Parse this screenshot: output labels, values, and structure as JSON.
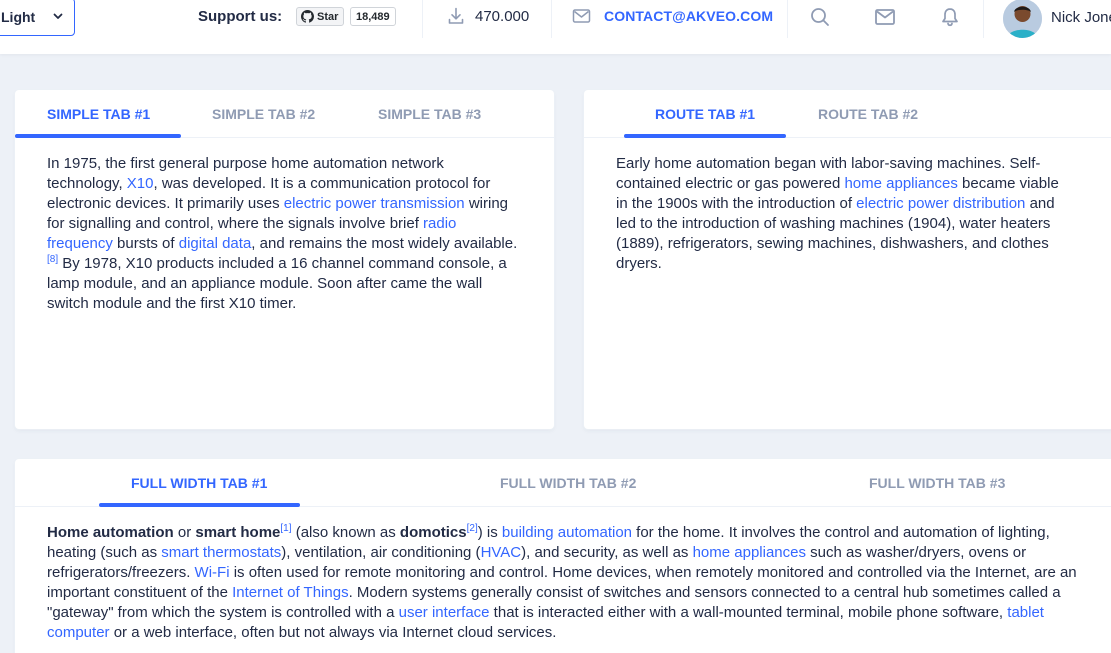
{
  "header": {
    "theme_select_value": "Light",
    "support_label": "Support us:",
    "github_star_label": "Star",
    "github_star_count": "18,489",
    "downloads_count": "470.000",
    "contact_email": "CONTACT@AKVEO.COM",
    "user_name": "Nick Jones"
  },
  "simple_tabs": {
    "tabs": [
      "SIMPLE TAB #1",
      "SIMPLE TAB #2",
      "SIMPLE TAB #3"
    ],
    "active_index": 0,
    "content": {
      "t1": "In 1975, the first general purpose home automation network technology, ",
      "l1": "X10",
      "t2": ", was developed. It is a communication protocol for electronic devices. It primarily uses ",
      "l2": "electric power transmission",
      "t3": " wiring for signalling and control, where the signals involve brief ",
      "l3": "radio frequency",
      "t4": " bursts of ",
      "l4": "digital data",
      "t5": ", and remains the most widely available.",
      "ref": "[8]",
      "t6": " By 1978, X10 products included a 16 channel command console, a lamp module, and an appliance module. Soon after came the wall switch module and the first X10 timer."
    }
  },
  "route_tabs": {
    "tabs": [
      "ROUTE TAB #1",
      "ROUTE TAB #2"
    ],
    "active_index": 0,
    "content": {
      "t1": "Early home automation began with labor-saving machines. Self-contained electric or gas powered ",
      "l1": "home appliances",
      "t2": " became viable in the 1900s with the introduction of ",
      "l2": "electric power distribution",
      "t3": " and led to the introduction of washing machines (1904), water heaters (1889), refrigerators, sewing machines, dishwashers, and clothes dryers."
    }
  },
  "full_tabs": {
    "tabs": [
      "FULL WIDTH TAB #1",
      "FULL WIDTH TAB #2",
      "FULL WIDTH TAB #3"
    ],
    "active_index": 0,
    "content": {
      "b1": "Home automation",
      "t1": " or ",
      "b2": "smart home",
      "ref1": "[1]",
      "t2": " (also known as ",
      "b3": "domotics",
      "ref2": "[2]",
      "t3": ") is ",
      "l1": "building automation",
      "t4": " for the home. It involves the control and automation of lighting, heating (such as ",
      "l2": "smart thermostats",
      "t5": "), ventilation, air conditioning (",
      "l3": "HVAC",
      "t6": "), and security, as well as ",
      "l4": "home appliances",
      "t7": " such as washer/dryers, ovens or refrigerators/freezers. ",
      "l5": "Wi-Fi",
      "t8": " is often used for remote monitoring and control. Home devices, when remotely monitored and controlled via the Internet, are an important constituent of the ",
      "l6": "Internet of Things",
      "t9": ". Modern systems generally consist of switches and sensors connected to a central hub sometimes called a \"gateway\" from which the system is controlled with a ",
      "l7": "user interface",
      "t10": " that is interacted either with a wall-mounted terminal, mobile phone software, ",
      "l8": "tablet computer",
      "t11": " or a web interface, often but not always via Internet cloud services."
    }
  },
  "colors": {
    "accent": "#3366ff",
    "inactive_tab": "#8f9bb3",
    "text": "#222b45",
    "background": "#edf1f7"
  },
  "icons": [
    "chevron-down-icon",
    "github-icon",
    "download-icon",
    "mail-icon",
    "search-icon",
    "email-icon",
    "bell-icon"
  ]
}
